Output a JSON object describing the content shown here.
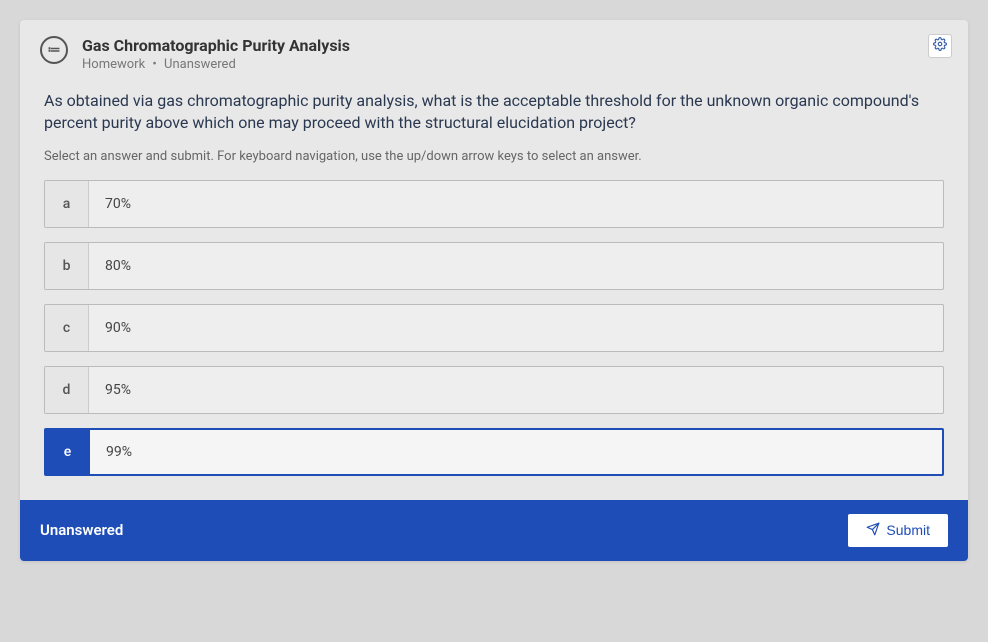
{
  "header": {
    "icon_glyph": "≔",
    "title": "Gas Chromatographic Purity Analysis",
    "category": "Homework",
    "status": "Unanswered"
  },
  "question": {
    "text": "As obtained via gas chromatographic purity analysis, what is the acceptable threshold for the unknown organic compound's percent purity above which one may proceed with the structural elucidation project?",
    "instruction": "Select an answer and submit. For keyboard navigation, use the up/down arrow keys to select an answer."
  },
  "options": [
    {
      "key": "a",
      "label": "70%",
      "selected": false
    },
    {
      "key": "b",
      "label": "80%",
      "selected": false
    },
    {
      "key": "c",
      "label": "90%",
      "selected": false
    },
    {
      "key": "d",
      "label": "95%",
      "selected": false
    },
    {
      "key": "e",
      "label": "99%",
      "selected": true
    }
  ],
  "footer": {
    "status": "Unanswered",
    "submit_label": "Submit"
  }
}
